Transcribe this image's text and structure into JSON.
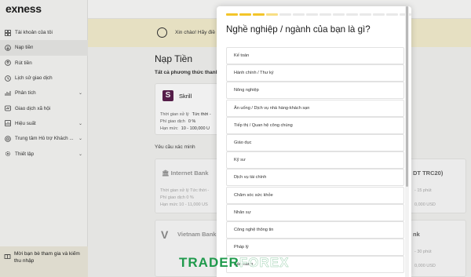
{
  "sidebar": {
    "logo": "exness",
    "items": [
      {
        "label": "Tài khoản của tôi",
        "icon": "grid-icon",
        "chevron": ""
      },
      {
        "label": "Nạp tiền",
        "icon": "deposit-icon",
        "chevron": "",
        "active": true
      },
      {
        "label": "Rút tiền",
        "icon": "withdraw-icon",
        "chevron": ""
      },
      {
        "label": "Lịch sử giao dịch",
        "icon": "history-icon",
        "chevron": ""
      },
      {
        "label": "Phân tích",
        "icon": "analytics-icon",
        "chevron": "⌄"
      },
      {
        "label": "Giao dịch xã hội",
        "icon": "social-icon",
        "chevron": ""
      },
      {
        "label": "Hiệu suất",
        "icon": "performance-icon",
        "chevron": "⌄"
      },
      {
        "label": "Trung tâm Hỗ trợ Khách ...",
        "icon": "support-icon",
        "chevron": "⌄"
      },
      {
        "label": "Thiết lập",
        "icon": "settings-icon",
        "chevron": "⌄"
      }
    ],
    "promo": "Mời bạn bè tham gia và kiếm thu nhập"
  },
  "main": {
    "greeting": "Xin chào! Hãy điề",
    "title": "Nạp Tiền",
    "subtitle": "Tất cả phương thức thanh",
    "skrill": {
      "logo": "S",
      "name": "Skrill",
      "rows": [
        {
          "k": "Thời gian xử lý",
          "v": "Tức thời -"
        },
        {
          "k": "Phí giao dịch",
          "v": "0 %"
        },
        {
          "k": "Hạn mức",
          "v": "10 - 100,000 U"
        }
      ]
    },
    "verify_label": "Yêu cầu xác minh",
    "internet_bank": {
      "name": "Internet Bank",
      "rows": [
        {
          "k": "Thời gian xử lý",
          "v": "Tức thời -"
        },
        {
          "k": "Phí giao dịch",
          "v": "0 %"
        },
        {
          "k": "Hạn mức",
          "v": "10 - 11,000 US"
        }
      ]
    },
    "vietnam_bank": {
      "logo": "V",
      "name": "Vietnam Bank"
    },
    "right_card": {
      "name": "DT TRC20)",
      "rows": [
        "- 15 phút",
        "0,000 USD"
      ]
    },
    "right_card2": {
      "name": "nk",
      "rows": [
        "- 30 phút",
        "0,000 USD"
      ]
    }
  },
  "modal": {
    "progress": {
      "total": 16,
      "done": 3,
      "half": 1
    },
    "question": "Nghề nghiệp / ngành của bạn là gì?",
    "options": [
      "Kế toán",
      "Hành chính / Thư ký",
      "Nông nghiệp",
      "Ăn uống / Dịch vụ nhà hàng-khách sạn",
      "Tiếp thị / Quan hệ công chúng",
      "Giáo dục",
      "Kỹ sư",
      "Dịch vụ tài chính",
      "Chăm sóc sức khỏe",
      "Nhân sự",
      "Công nghệ thông tin",
      "Pháp lý",
      "Bán hàng"
    ]
  },
  "watermark": {
    "part1": "TRADER",
    "part2": "FOREX"
  },
  "colors": {
    "accent": "#f3c52a",
    "skrill": "#5b1f4e",
    "banner": "#f5efcf",
    "watermark": "#1f9a4c"
  }
}
